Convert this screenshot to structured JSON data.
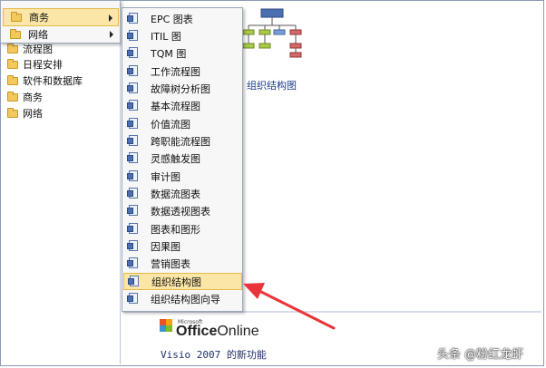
{
  "top_menu": {
    "items": [
      {
        "label": "商务",
        "highlighted": true
      },
      {
        "label": "网络",
        "highlighted": false
      }
    ]
  },
  "left_tree": {
    "items": [
      {
        "label": "流程图"
      },
      {
        "label": "日程安排"
      },
      {
        "label": "软件和数据库"
      },
      {
        "label": "商务"
      },
      {
        "label": "网络"
      }
    ]
  },
  "submenu": {
    "items": [
      {
        "label": "EPC 图表"
      },
      {
        "label": "ITIL 图"
      },
      {
        "label": "TQM 图"
      },
      {
        "label": "工作流程图"
      },
      {
        "label": "故障树分析图"
      },
      {
        "label": "基本流程图"
      },
      {
        "label": "价值流图"
      },
      {
        "label": "跨职能流程图"
      },
      {
        "label": "灵感触发图"
      },
      {
        "label": "审计图"
      },
      {
        "label": "数据流图表"
      },
      {
        "label": "数据透视图表"
      },
      {
        "label": "图表和图形"
      },
      {
        "label": "因果图"
      },
      {
        "label": "营销图表"
      },
      {
        "label": "组织结构图",
        "highlighted": true
      },
      {
        "label": "组织结构图向导"
      }
    ]
  },
  "right_area": {
    "template_label": "组织结构图",
    "office_small": "Microsoft",
    "office_brand": "Office",
    "office_online": "Online",
    "visio_news": "Visio 2007 的新功能"
  },
  "watermark": "头条 @粉红龙虾",
  "colors": {
    "highlight_bg": "#fbe6a8",
    "highlight_border": "#e5b949",
    "arrow": "#e8343a",
    "link": "#1e3f8a"
  }
}
